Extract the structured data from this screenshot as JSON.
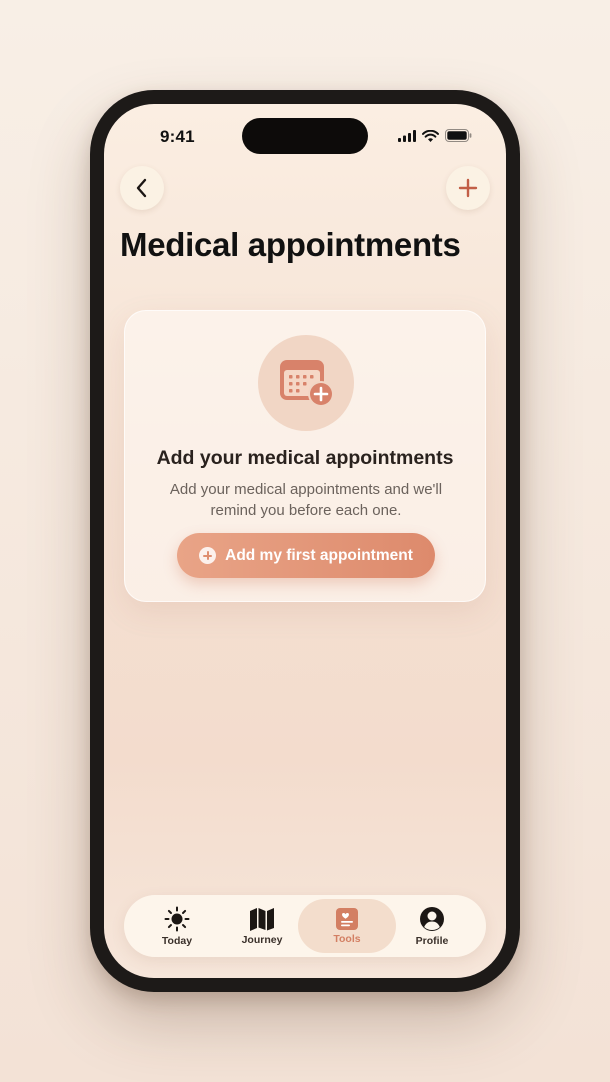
{
  "status_bar": {
    "time": "9:41"
  },
  "header": {
    "title": "Medical appointments"
  },
  "empty_state": {
    "title": "Add your medical appointments",
    "description": "Add your medical appointments and we'll remind you before each one.",
    "cta_label": "Add my first appointment",
    "icon": "calendar-add-icon"
  },
  "tabs": [
    {
      "label": "Today",
      "icon": "sun-icon",
      "active": false
    },
    {
      "label": "Journey",
      "icon": "map-icon",
      "active": false
    },
    {
      "label": "Tools",
      "icon": "tools-card-icon",
      "active": true
    },
    {
      "label": "Profile",
      "icon": "profile-icon",
      "active": false
    }
  ],
  "colors": {
    "accent": "#dd8a6c",
    "accent_light": "#f1d6c5",
    "background": "#f6e6da"
  }
}
